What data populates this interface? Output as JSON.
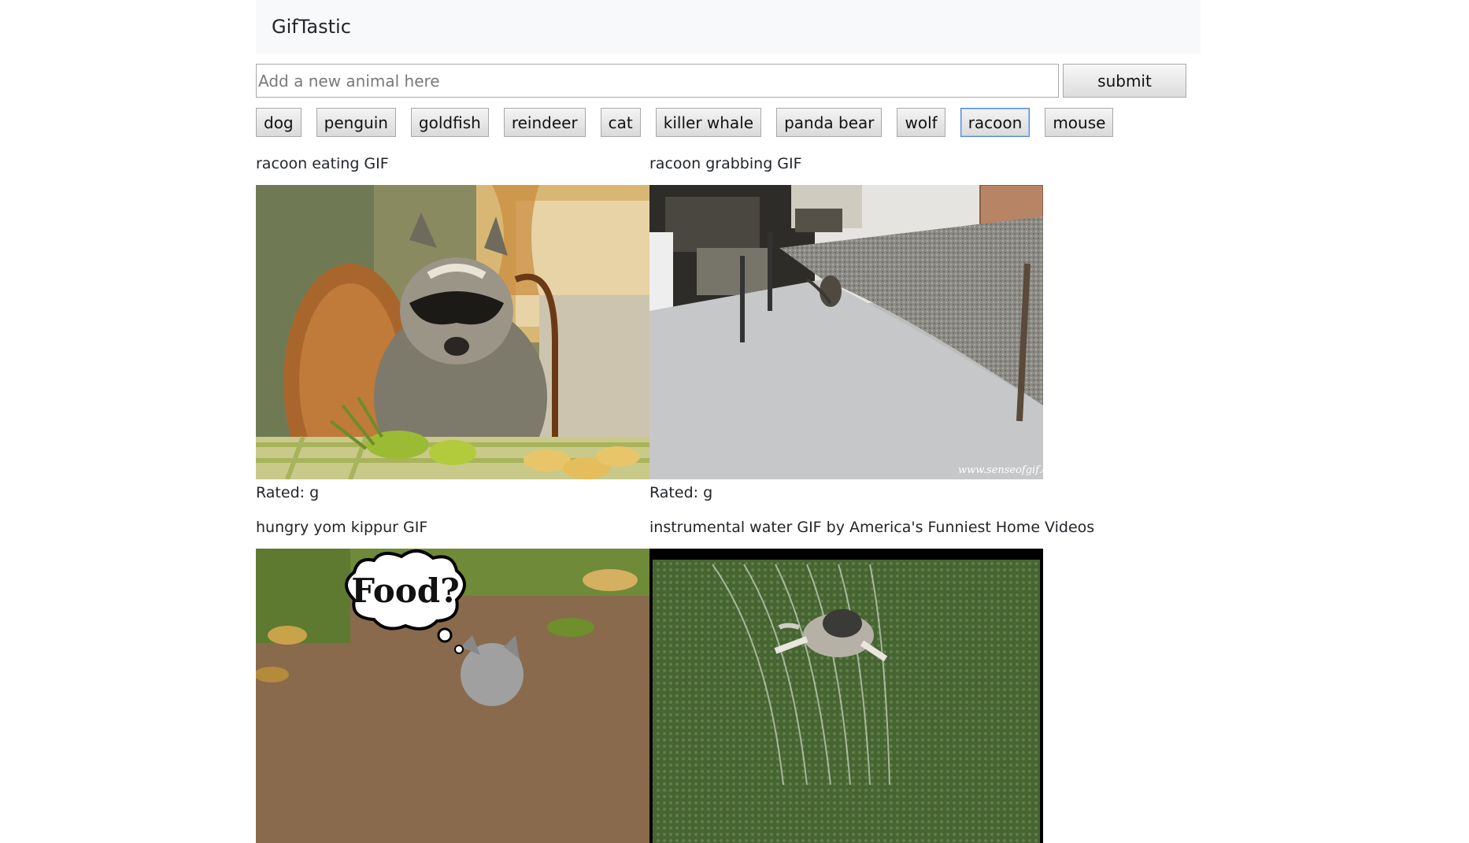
{
  "app": {
    "title": "GifTastic"
  },
  "form": {
    "input_placeholder": "Add a new animal here",
    "input_value": "",
    "submit_label": "submit"
  },
  "animals": [
    "dog",
    "penguin",
    "goldfish",
    "reindeer",
    "cat",
    "killer whale",
    "panda bear",
    "wolf",
    "racoon",
    "mouse"
  ],
  "active_animal": "racoon",
  "gifs": [
    {
      "title": "racoon eating GIF",
      "rating": "Rated: g",
      "image": "raccoon-eating"
    },
    {
      "title": "racoon grabbing GIF",
      "rating": "Rated: g",
      "image": "raccoon-grabbing",
      "watermark": "www.senseofgif.com"
    },
    {
      "title": "hungry yom kippur GIF",
      "rating": "",
      "image": "raccoon-food",
      "bubble_text": "Food?"
    },
    {
      "title": "instrumental water GIF by America's Funniest Home Videos",
      "rating": "",
      "image": "raccoon-sprinkler"
    }
  ]
}
